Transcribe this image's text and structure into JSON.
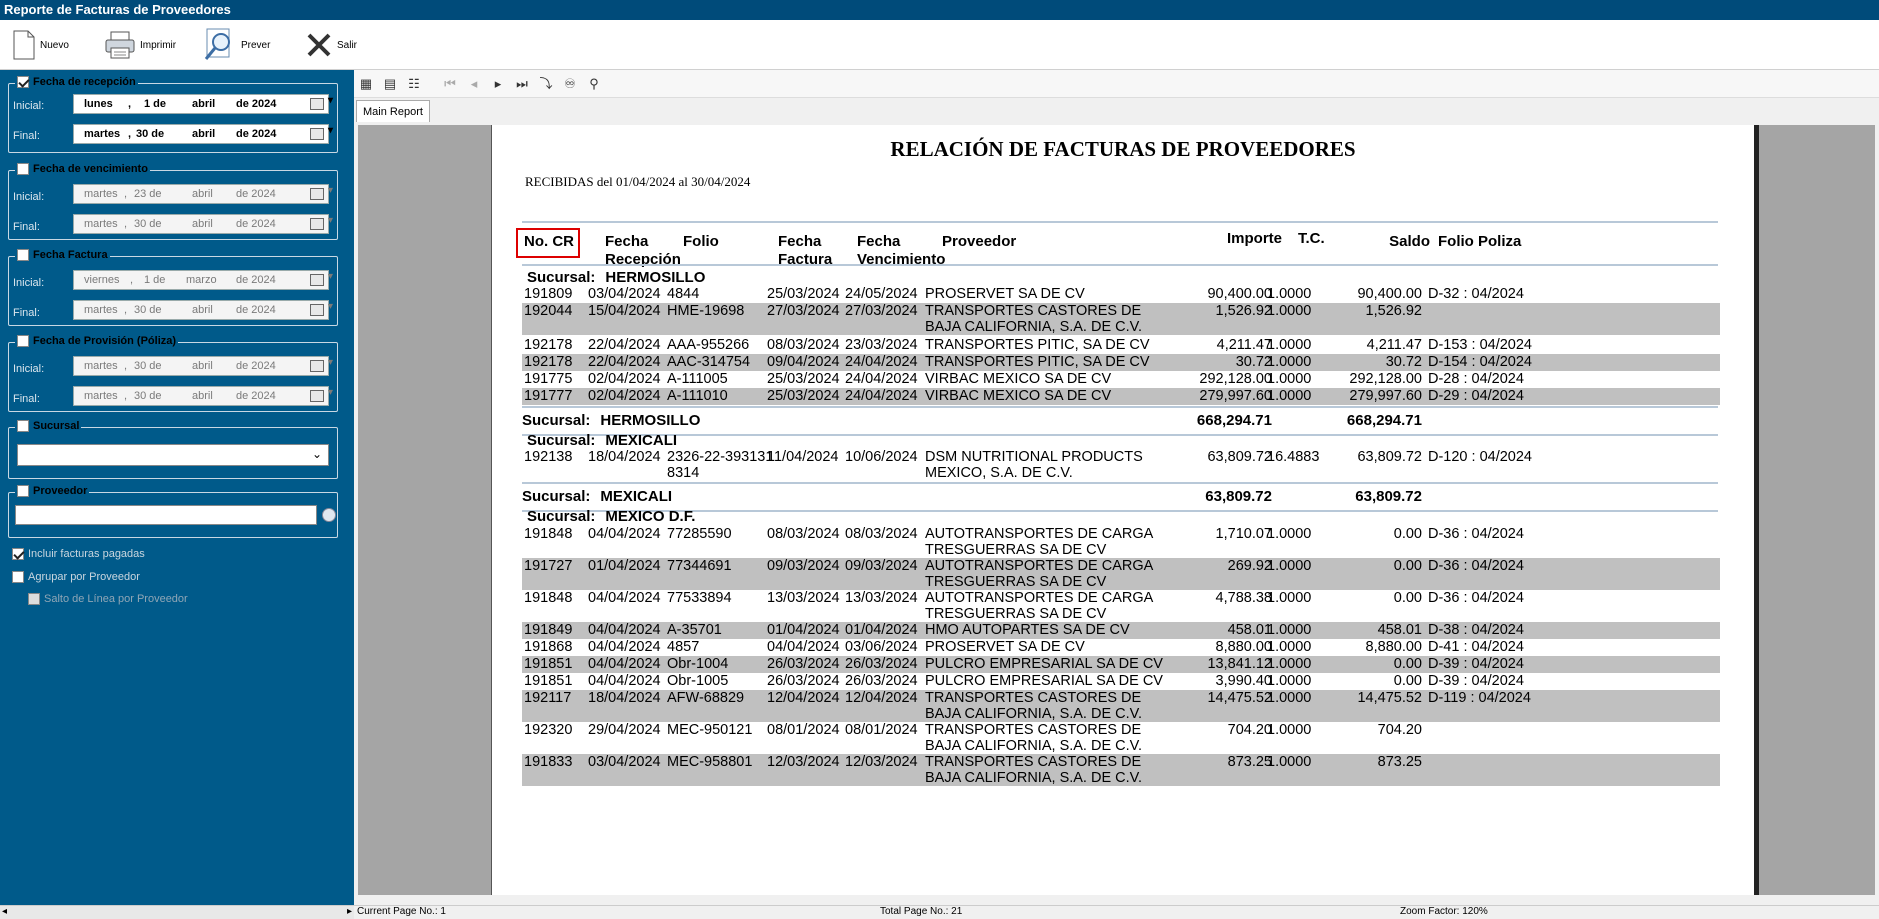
{
  "window": {
    "title": "Reporte de Facturas de Proveedores"
  },
  "toolbar": {
    "new": "Nuevo",
    "print": "Imprimir",
    "preview": "Prever",
    "exit": "Salir"
  },
  "filters": {
    "recepcion": {
      "title": "Fecha de recepción",
      "checked": true,
      "inicial": {
        "label": "Inicial:",
        "day": "lunes",
        "num": "1 de",
        "month": "abril",
        "year": "de 2024"
      },
      "final": {
        "label": "Final:",
        "day": "martes",
        "num": "30 de",
        "month": "abril",
        "year": "de 2024"
      }
    },
    "vencimiento": {
      "title": "Fecha de vencimiento",
      "inicial": {
        "label": "Inicial:",
        "day": "martes",
        "num": "23 de",
        "month": "abril",
        "year": "de 2024"
      },
      "final": {
        "label": "Final:",
        "day": "martes",
        "num": "30 de",
        "month": "abril",
        "year": "de 2024"
      }
    },
    "factura": {
      "title": "Fecha Factura",
      "inicial": {
        "label": "Inicial:",
        "day": "viernes",
        "num": "1 de",
        "month": "marzo",
        "year": "de 2024"
      },
      "final": {
        "label": "Final:",
        "day": "martes",
        "num": "30 de",
        "month": "abril",
        "year": "de 2024"
      }
    },
    "provision": {
      "title": "Fecha de Provisión (Póliza)",
      "inicial": {
        "label": "Inicial:",
        "day": "martes",
        "num": "30 de",
        "month": "abril",
        "year": "de 2024"
      },
      "final": {
        "label": "Final:",
        "day": "martes",
        "num": "30 de",
        "month": "abril",
        "year": "de 2024"
      }
    },
    "sucursal": {
      "title": "Sucursal"
    },
    "proveedor": {
      "title": "Proveedor"
    },
    "incluir_pagadas": "Incluir facturas pagadas",
    "agrupar": "Agrupar por Proveedor",
    "salto": "Salto de Línea por Proveedor"
  },
  "viewer": {
    "tab": "Main Report",
    "current_page": "Current Page No.: 1",
    "total_pages": "Total Page No.: 21",
    "zoom": "Zoom Factor: 120%"
  },
  "report": {
    "title": "RELACIÓN DE FACTURAS DE PROVEEDORES",
    "subtitle": "RECIBIDAS del 01/04/2024 al 30/04/2024",
    "headers": {
      "nocr": "No. CR",
      "fecha_rec_1": "Fecha",
      "fecha_rec_2": "Recepción",
      "folio": "Folio",
      "fecha_fac_1": "Fecha",
      "fecha_fac_2": "Factura",
      "fecha_ven_1": "Fecha",
      "fecha_ven_2": "Vencimiento",
      "proveedor": "Proveedor",
      "importe": "Importe",
      "tc": "T.C.",
      "saldo": "Saldo",
      "folio_poliza": "Folio Poliza"
    },
    "sucursal_label": "Sucursal:",
    "groups": [
      {
        "name": "HERMOSILLO",
        "total_importe": "668,294.71",
        "total_saldo": "668,294.71",
        "rows": [
          [
            "191809",
            "03/04/2024",
            "4844",
            "25/03/2024",
            "24/05/2024",
            "PROSERVET SA DE CV",
            "",
            "90,400.00",
            "1.0000",
            "90,400.00",
            "D-32 : 04/2024"
          ],
          [
            "192044",
            "15/04/2024",
            "HME-19698",
            "27/03/2024",
            "27/03/2024",
            "TRANSPORTES CASTORES DE",
            "BAJA CALIFORNIA, S.A. DE C.V.",
            "1,526.92",
            "1.0000",
            "1,526.92",
            ""
          ],
          [
            "192178",
            "22/04/2024",
            "AAA-955266",
            "08/03/2024",
            "23/03/2024",
            "TRANSPORTES PITIC, SA DE CV",
            "",
            "4,211.47",
            "1.0000",
            "4,211.47",
            "D-153 : 04/2024"
          ],
          [
            "192178",
            "22/04/2024",
            "AAC-314754",
            "09/04/2024",
            "24/04/2024",
            "TRANSPORTES PITIC, SA DE CV",
            "",
            "30.72",
            "1.0000",
            "30.72",
            "D-154 : 04/2024"
          ],
          [
            "191775",
            "02/04/2024",
            "A-111005",
            "25/03/2024",
            "24/04/2024",
            "VIRBAC MEXICO SA DE CV",
            "",
            "292,128.00",
            "1.0000",
            "292,128.00",
            "D-28 : 04/2024"
          ],
          [
            "191777",
            "02/04/2024",
            "A-111010",
            "25/03/2024",
            "24/04/2024",
            "VIRBAC MEXICO SA DE CV",
            "",
            "279,997.60",
            "1.0000",
            "279,997.60",
            "D-29 : 04/2024"
          ]
        ]
      },
      {
        "name": "MEXICALI",
        "total_importe": "63,809.72",
        "total_saldo": "63,809.72",
        "rows": [
          [
            "192138",
            "18/04/2024",
            "2326-22-393131|8314",
            "11/04/2024",
            "10/06/2024",
            "DSM NUTRITIONAL PRODUCTS",
            "MEXICO, S.A. DE C.V.",
            "63,809.72",
            "16.4883",
            "63,809.72",
            "D-120 : 04/2024"
          ]
        ]
      },
      {
        "name": "MEXICO D.F.",
        "rows": [
          [
            "191848",
            "04/04/2024",
            "77285590",
            "08/03/2024",
            "08/03/2024",
            "AUTOTRANSPORTES DE CARGA",
            "TRESGUERRAS SA DE CV",
            "1,710.07",
            "1.0000",
            "0.00",
            "D-36 : 04/2024"
          ],
          [
            "191727",
            "01/04/2024",
            "77344691",
            "09/03/2024",
            "09/03/2024",
            "AUTOTRANSPORTES DE CARGA",
            "TRESGUERRAS SA DE CV",
            "269.92",
            "1.0000",
            "0.00",
            "D-36 : 04/2024"
          ],
          [
            "191848",
            "04/04/2024",
            "77533894",
            "13/03/2024",
            "13/03/2024",
            "AUTOTRANSPORTES DE CARGA",
            "TRESGUERRAS SA DE CV",
            "4,788.38",
            "1.0000",
            "0.00",
            "D-36 : 04/2024"
          ],
          [
            "191849",
            "04/04/2024",
            "A-35701",
            "01/04/2024",
            "01/04/2024",
            "HMO AUTOPARTES SA DE CV",
            "",
            "458.01",
            "1.0000",
            "458.01",
            "D-38 : 04/2024"
          ],
          [
            "191868",
            "04/04/2024",
            "4857",
            "04/04/2024",
            "03/06/2024",
            "PROSERVET SA DE CV",
            "",
            "8,880.00",
            "1.0000",
            "8,880.00",
            "D-41 : 04/2024"
          ],
          [
            "191851",
            "04/04/2024",
            "Obr-1004",
            "26/03/2024",
            "26/03/2024",
            "PULCRO EMPRESARIAL SA DE CV",
            "",
            "13,841.12",
            "1.0000",
            "0.00",
            "D-39 : 04/2024"
          ],
          [
            "191851",
            "04/04/2024",
            "Obr-1005",
            "26/03/2024",
            "26/03/2024",
            "PULCRO EMPRESARIAL SA DE CV",
            "",
            "3,990.40",
            "1.0000",
            "0.00",
            "D-39 : 04/2024"
          ],
          [
            "192117",
            "18/04/2024",
            "AFW-68829",
            "12/04/2024",
            "12/04/2024",
            "TRANSPORTES CASTORES DE",
            "BAJA CALIFORNIA, S.A. DE C.V.",
            "14,475.52",
            "1.0000",
            "14,475.52",
            "D-119 : 04/2024"
          ],
          [
            "192320",
            "29/04/2024",
            "MEC-950121",
            "08/01/2024",
            "08/01/2024",
            "TRANSPORTES CASTORES DE",
            "BAJA CALIFORNIA, S.A. DE C.V.",
            "704.20",
            "1.0000",
            "704.20",
            ""
          ],
          [
            "191833",
            "03/04/2024",
            "MEC-958801",
            "12/03/2024",
            "12/03/2024",
            "TRANSPORTES CASTORES DE",
            "BAJA CALIFORNIA, S.A. DE C.V.",
            "873.25",
            "1.0000",
            "873.25",
            ""
          ]
        ]
      }
    ]
  }
}
